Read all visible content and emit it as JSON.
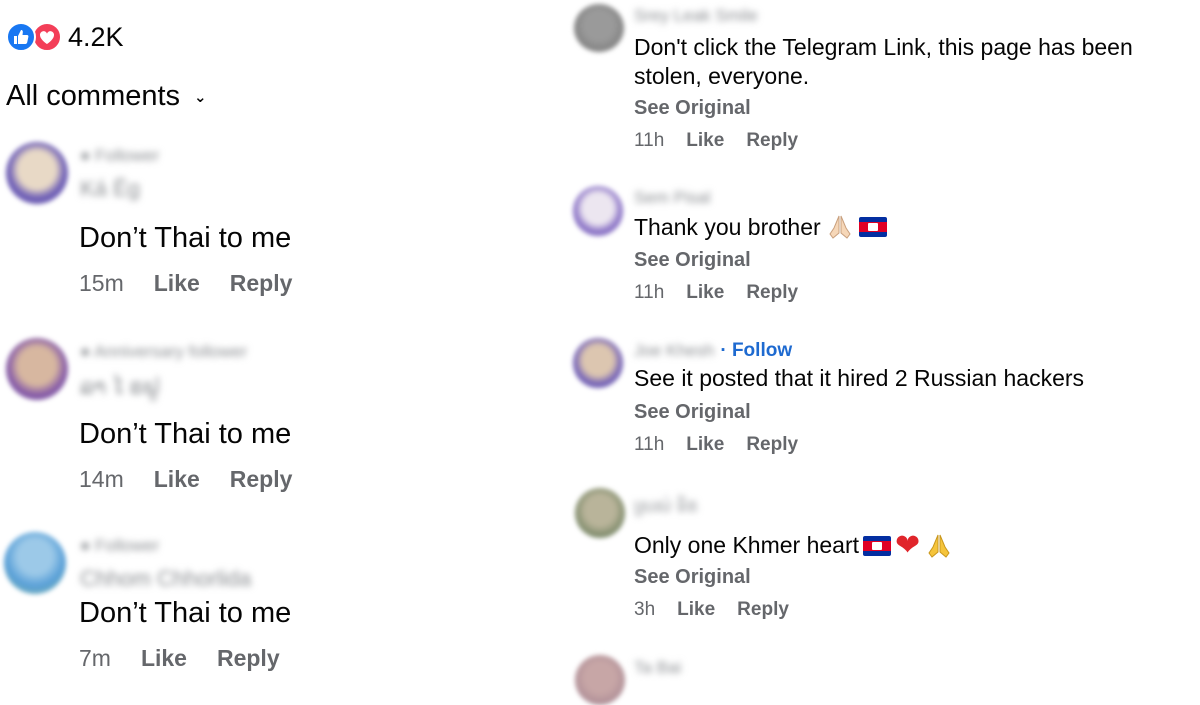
{
  "header": {
    "reaction_count": "4.2K",
    "sort_label": "All comments"
  },
  "left_comments": [
    {
      "badge": "Follower",
      "author": "Ká Ëg",
      "text": "Don’t Thai to me",
      "time": "15m",
      "like": "Like",
      "reply": "Reply"
    },
    {
      "badge": "Anniversary follower",
      "author": "ລາ ໄ ຣຟູ",
      "text": "Don’t Thai to me",
      "time": "14m",
      "like": "Like",
      "reply": "Reply"
    },
    {
      "badge": "Follower",
      "author": "Chhom Chhorlida",
      "text": "Don’t Thai to me",
      "time": "7m",
      "like": "Like",
      "reply": "Reply"
    }
  ],
  "right_comments": [
    {
      "author": "Srey Leak Smile",
      "text_line1": "Don't click the Telegram Link, this page has been",
      "text_line2": "stolen, everyone.",
      "see_original": "See Original",
      "time": "11h",
      "like": "Like",
      "reply": "Reply"
    },
    {
      "author": "Sem Pisal",
      "text": "Thank you brother",
      "see_original": "See Original",
      "time": "11h",
      "like": "Like",
      "reply": "Reply"
    },
    {
      "author": "Joe Khesh",
      "follow": "· Follow",
      "text": "See it posted that it hired 2 Russian hackers",
      "see_original": "See Original",
      "time": "11h",
      "like": "Like",
      "reply": "Reply"
    },
    {
      "author": "ស្រស់ ទិត",
      "text": "Only one Khmer heart",
      "see_original": "See Original",
      "time": "3h",
      "like": "Like",
      "reply": "Reply"
    },
    {
      "author": "Ta Bai"
    }
  ],
  "colors": {
    "like_blue": "#1877f2",
    "love_red": "#f33e58",
    "link_blue": "#1e6ad0",
    "meta_gray": "#65676b"
  }
}
